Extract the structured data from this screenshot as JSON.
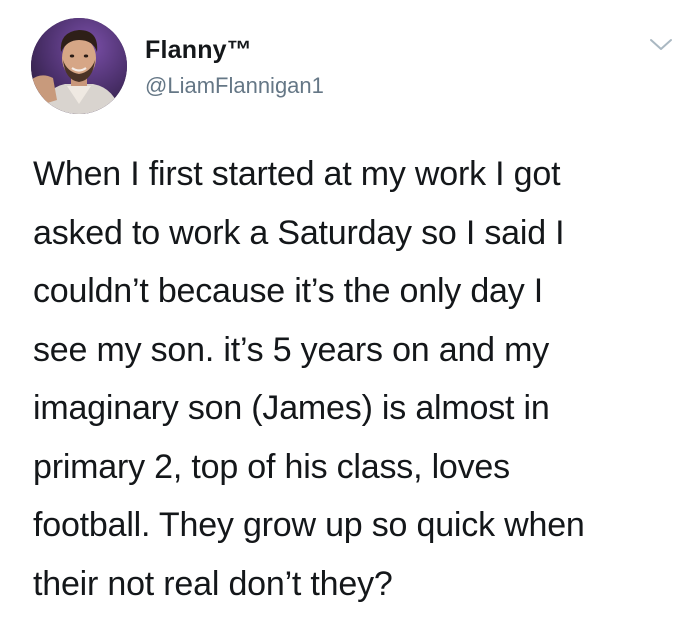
{
  "author": {
    "display_name": "Flanny™",
    "handle": "@LiamFlannigan1",
    "avatar_icon": "profile-photo"
  },
  "tweet": {
    "text": "When I first started at my work I got\nasked to work a Saturday so I said I\ncouldn’t because it’s the only day I\nsee my son. it’s 5 years on and my\nimaginary son (James) is almost in\nprimary 2, top of his class, loves\nfootball. They grow up so quick when\ntheir not real don’t they?"
  },
  "menu": {
    "icon": "chevron-down-icon",
    "color": "#aab8c2"
  },
  "colors": {
    "text": "#14171a",
    "secondary": "#657786"
  }
}
